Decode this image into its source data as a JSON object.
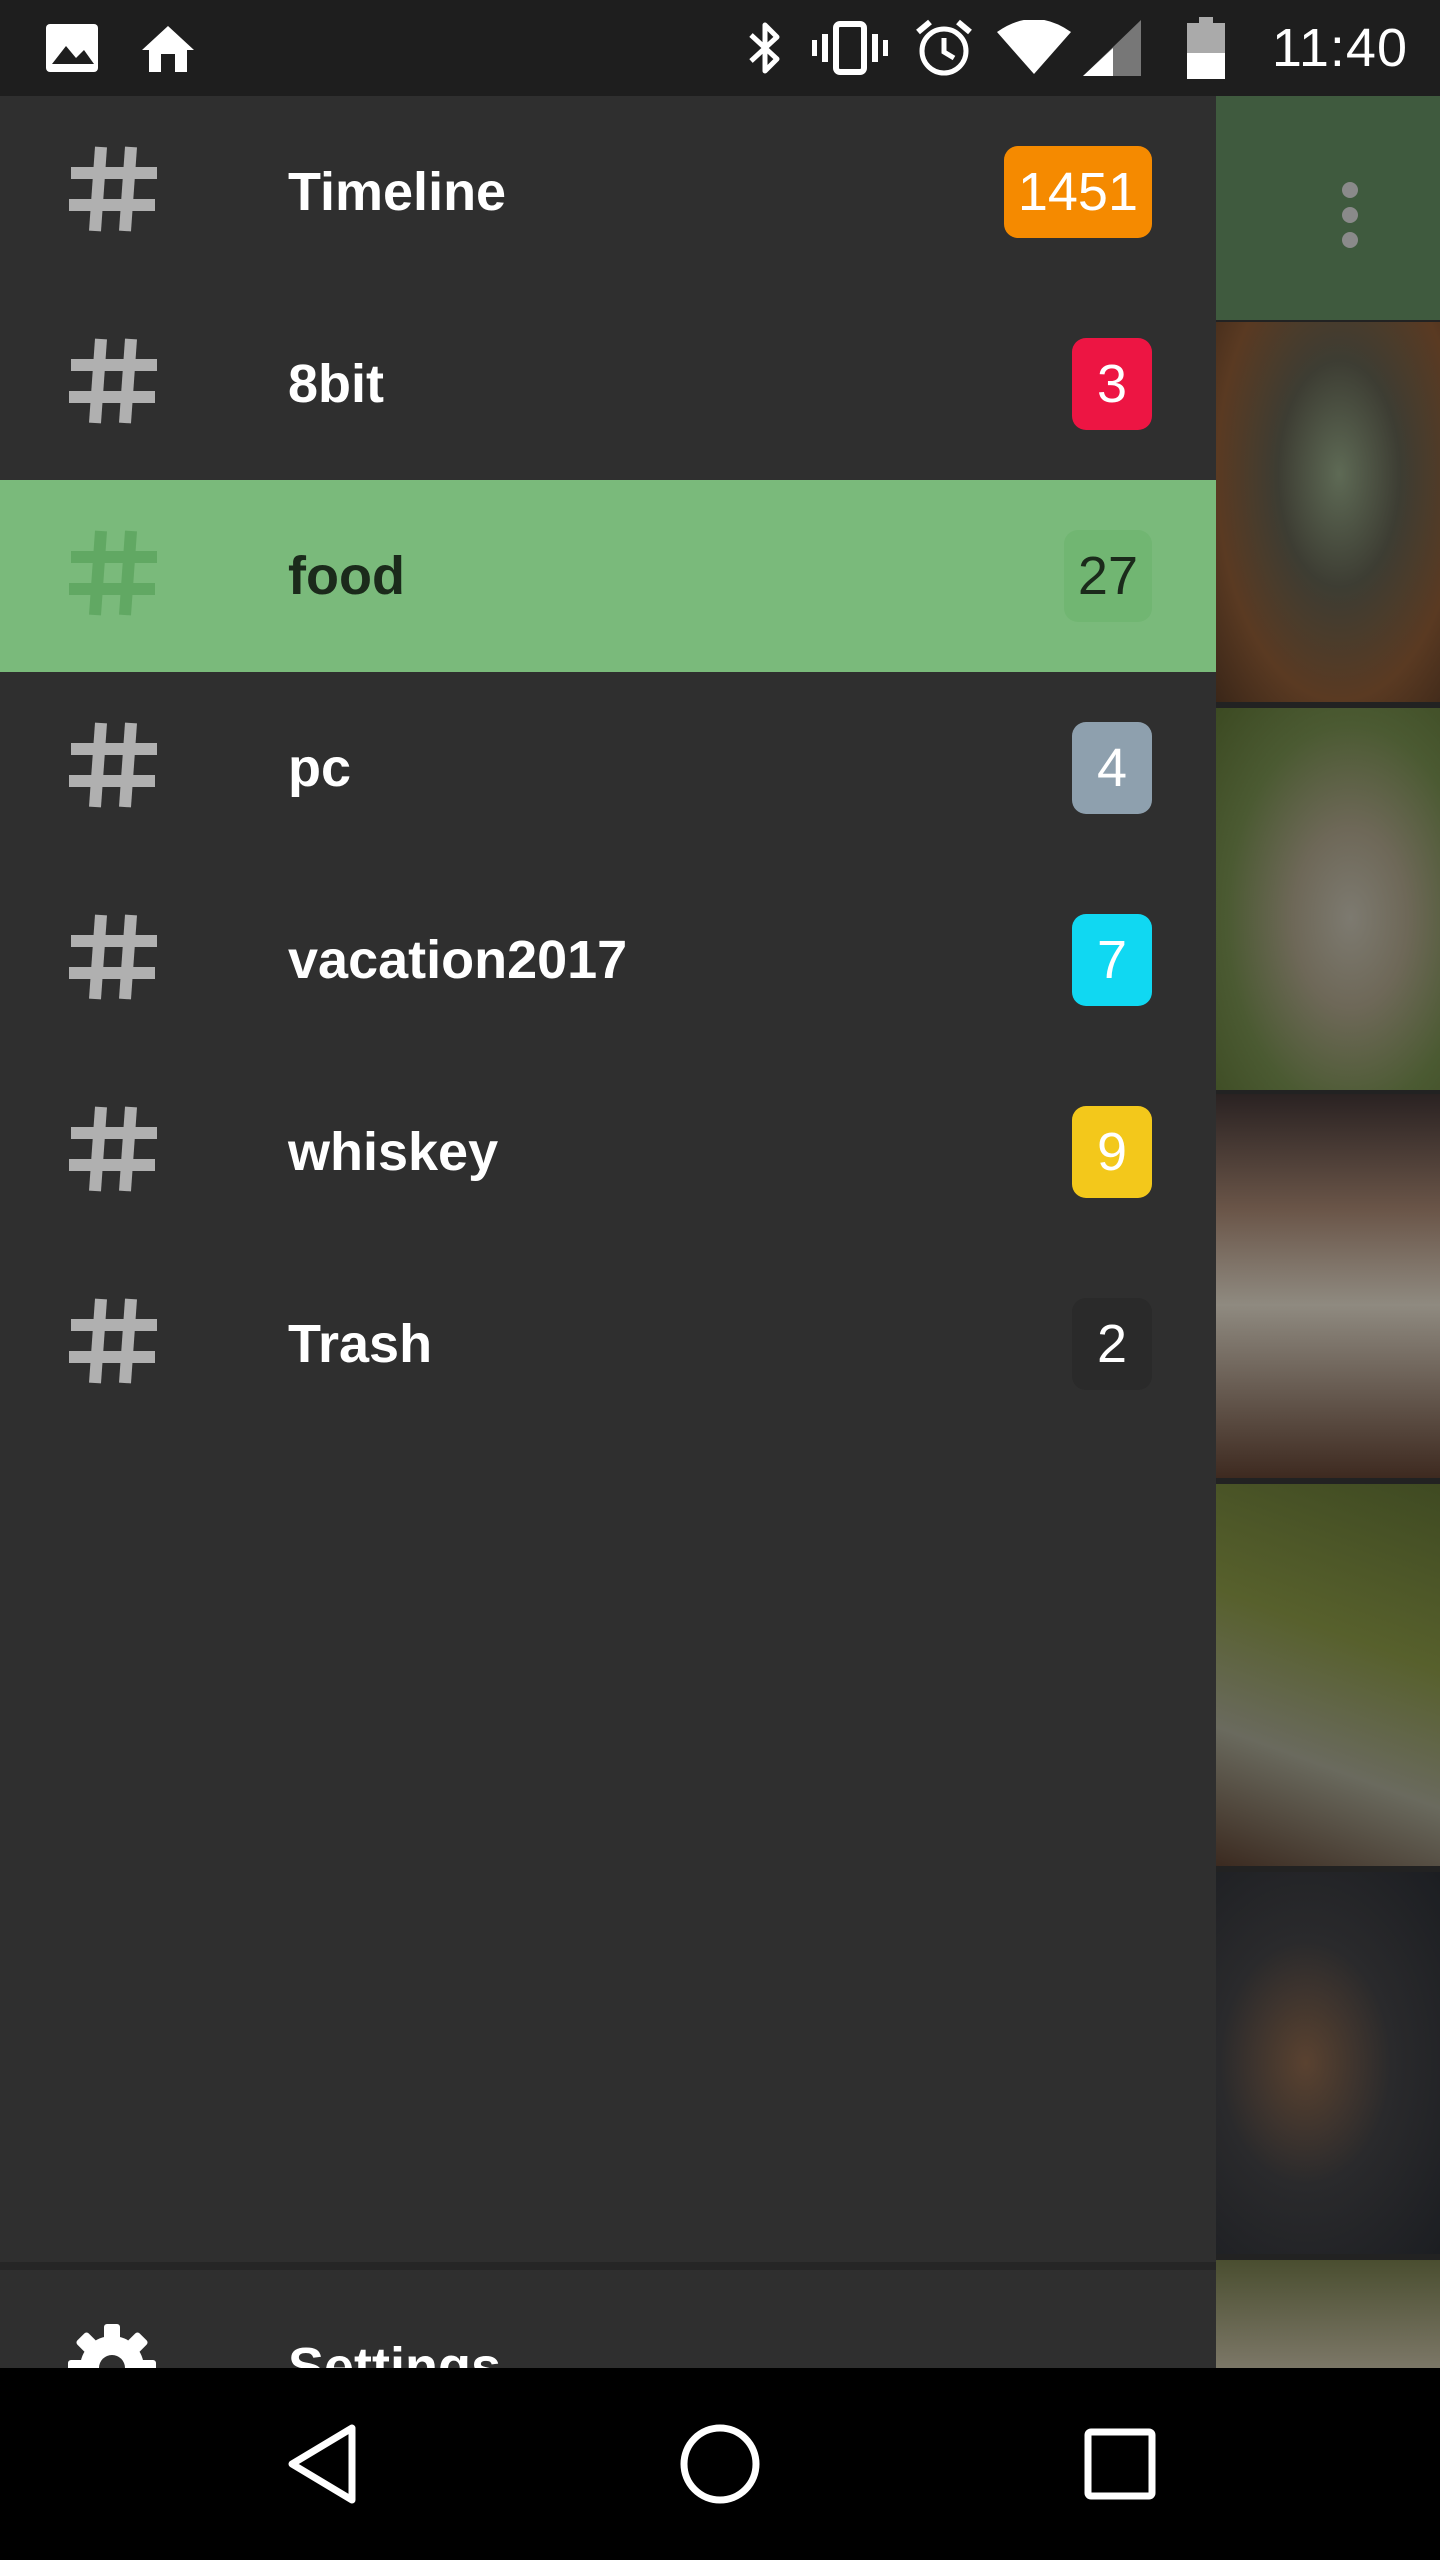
{
  "status_bar": {
    "time": "11:40",
    "icons": [
      "image-icon",
      "home-icon",
      "bluetooth-icon",
      "vibrate-icon",
      "alarm-icon",
      "wifi-icon",
      "cell-signal-icon",
      "battery-icon"
    ]
  },
  "drawer": {
    "items": [
      {
        "label": "Timeline",
        "count": "1451",
        "badge_color": "#f58a00",
        "active": false
      },
      {
        "label": "8bit",
        "count": "3",
        "badge_color": "#ed1543",
        "active": false
      },
      {
        "label": "food",
        "count": "27",
        "badge_color": "#71b672",
        "active": true
      },
      {
        "label": "pc",
        "count": "4",
        "badge_color": "#8ea0ae",
        "active": false
      },
      {
        "label": "vacation2017",
        "count": "7",
        "badge_color": "#10d8f2",
        "active": false
      },
      {
        "label": "whiskey",
        "count": "9",
        "badge_color": "#f3c81b",
        "active": false
      },
      {
        "label": "Trash",
        "count": "2",
        "badge_color": "#2a2a2a",
        "active": false
      }
    ],
    "settings_label": "Settings"
  },
  "colors": {
    "drawer_bg": "#2f2f2f",
    "active_bg": "#7aba7b",
    "statusbar_bg": "#1e1e1e",
    "toolbar_bg": "#3f5a3e"
  },
  "nav_bar": {
    "buttons": [
      "back-icon",
      "home-circle-icon",
      "recents-icon"
    ]
  }
}
